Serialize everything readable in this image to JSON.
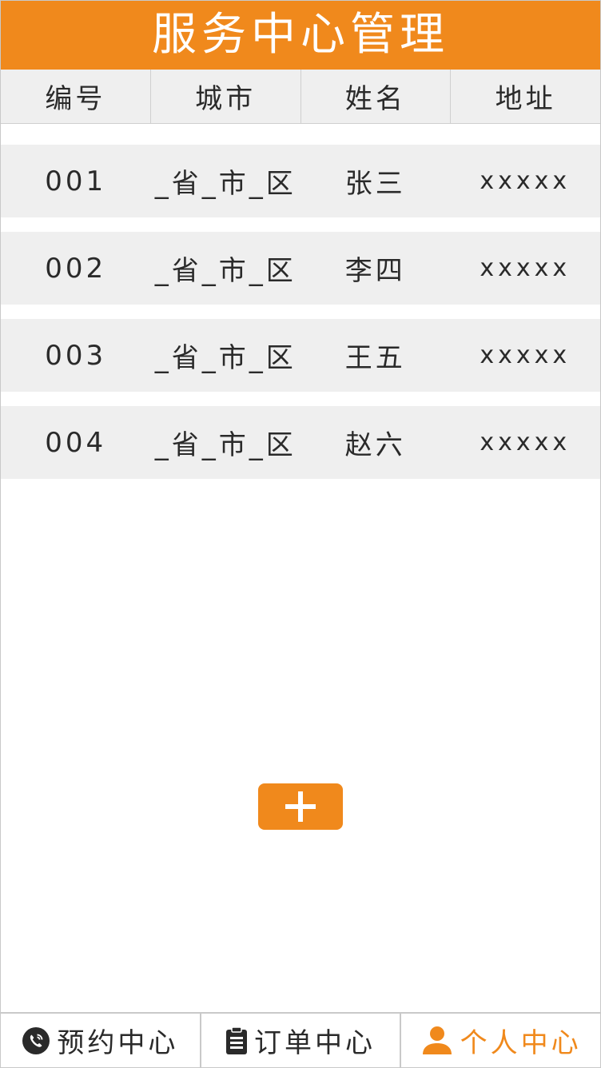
{
  "header": {
    "title": "服务中心管理"
  },
  "table": {
    "columns": [
      "编号",
      "城市",
      "姓名",
      "地址"
    ],
    "rows": [
      {
        "id": "001",
        "city": "_省_市_区",
        "name": "张三",
        "address": "xxxxx"
      },
      {
        "id": "002",
        "city": "_省_市_区",
        "name": "李四",
        "address": "xxxxx"
      },
      {
        "id": "003",
        "city": "_省_市_区",
        "name": "王五",
        "address": "xxxxx"
      },
      {
        "id": "004",
        "city": "_省_市_区",
        "name": "赵六",
        "address": "xxxxx"
      }
    ]
  },
  "add_button": {
    "icon": "plus-icon"
  },
  "tabbar": {
    "items": [
      {
        "label": "预约中心",
        "icon": "phone-icon",
        "active": false
      },
      {
        "label": "订单中心",
        "icon": "clipboard-icon",
        "active": false
      },
      {
        "label": "个人中心",
        "icon": "user-icon",
        "active": true
      }
    ]
  },
  "colors": {
    "accent": "#f0891c",
    "row_background": "#efefef",
    "text": "#2a2a2a",
    "border": "#c9c9c9"
  }
}
